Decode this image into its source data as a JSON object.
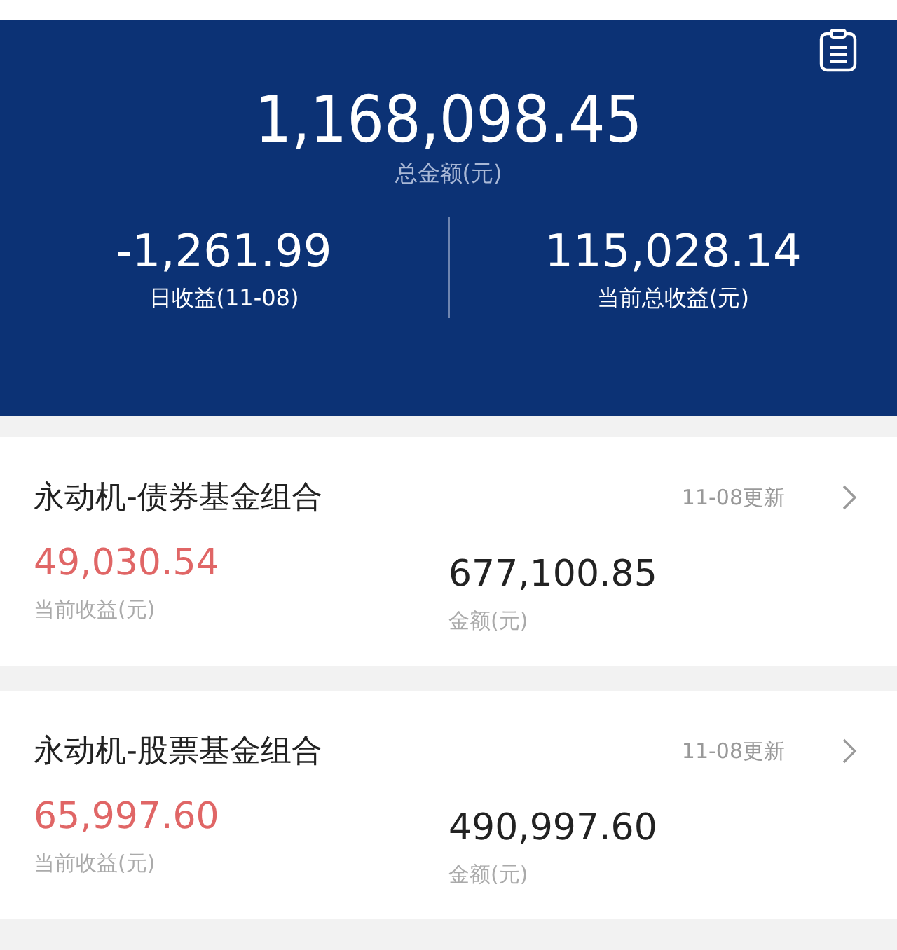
{
  "summary": {
    "total": "1,168,098.45",
    "total_label": "总金额(元)",
    "daily": "-1,261.99",
    "daily_label": "日收益(11-08)",
    "profit": "115,028.14",
    "profit_label": "当前总收益(元)"
  },
  "portfolios": [
    {
      "name": "永动机-债券基金组合",
      "updated": "11-08更新",
      "profit": "49,030.54",
      "profit_label": "当前收益(元)",
      "amount": "677,100.85",
      "amount_label": "金额(元)"
    },
    {
      "name": "永动机-股票基金组合",
      "updated": "11-08更新",
      "profit": "65,997.60",
      "profit_label": "当前收益(元)",
      "amount": "490,997.60",
      "amount_label": "金额(元)"
    }
  ]
}
